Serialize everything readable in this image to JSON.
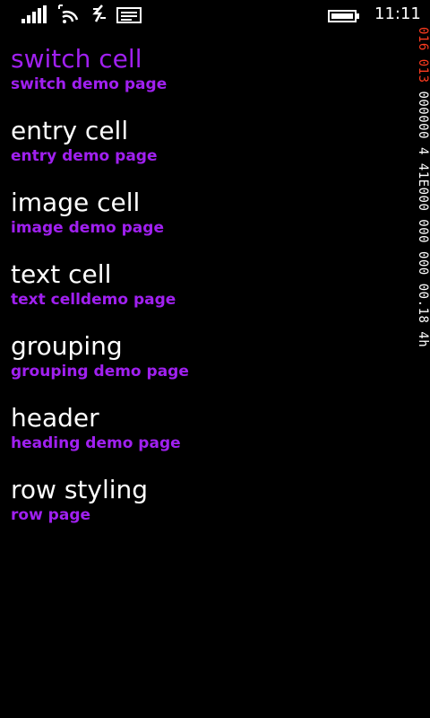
{
  "status_bar": {
    "time": "11:11",
    "icons": [
      "signal-icon",
      "wifi-icon",
      "data-icon",
      "message-icon",
      "battery-icon"
    ]
  },
  "debug_counter": {
    "highlight": "016 013",
    "rest": " 000000 4 41E000 000 000 00.18 4h"
  },
  "colors": {
    "background": "#000000",
    "text": "#ffffff",
    "accent": "#a020f0",
    "debug_red": "#ff3b1f"
  },
  "cells": [
    {
      "title": "switch cell",
      "detail": "switch demo page",
      "selected": true
    },
    {
      "title": "entry cell",
      "detail": "entry demo page",
      "selected": false
    },
    {
      "title": "image cell",
      "detail": "image demo page",
      "selected": false
    },
    {
      "title": "text cell",
      "detail": "text celldemo page",
      "selected": false
    },
    {
      "title": "grouping",
      "detail": "grouping demo page",
      "selected": false
    },
    {
      "title": "header",
      "detail": "heading demo page",
      "selected": false
    },
    {
      "title": "row styling",
      "detail": "row page",
      "selected": false
    }
  ]
}
